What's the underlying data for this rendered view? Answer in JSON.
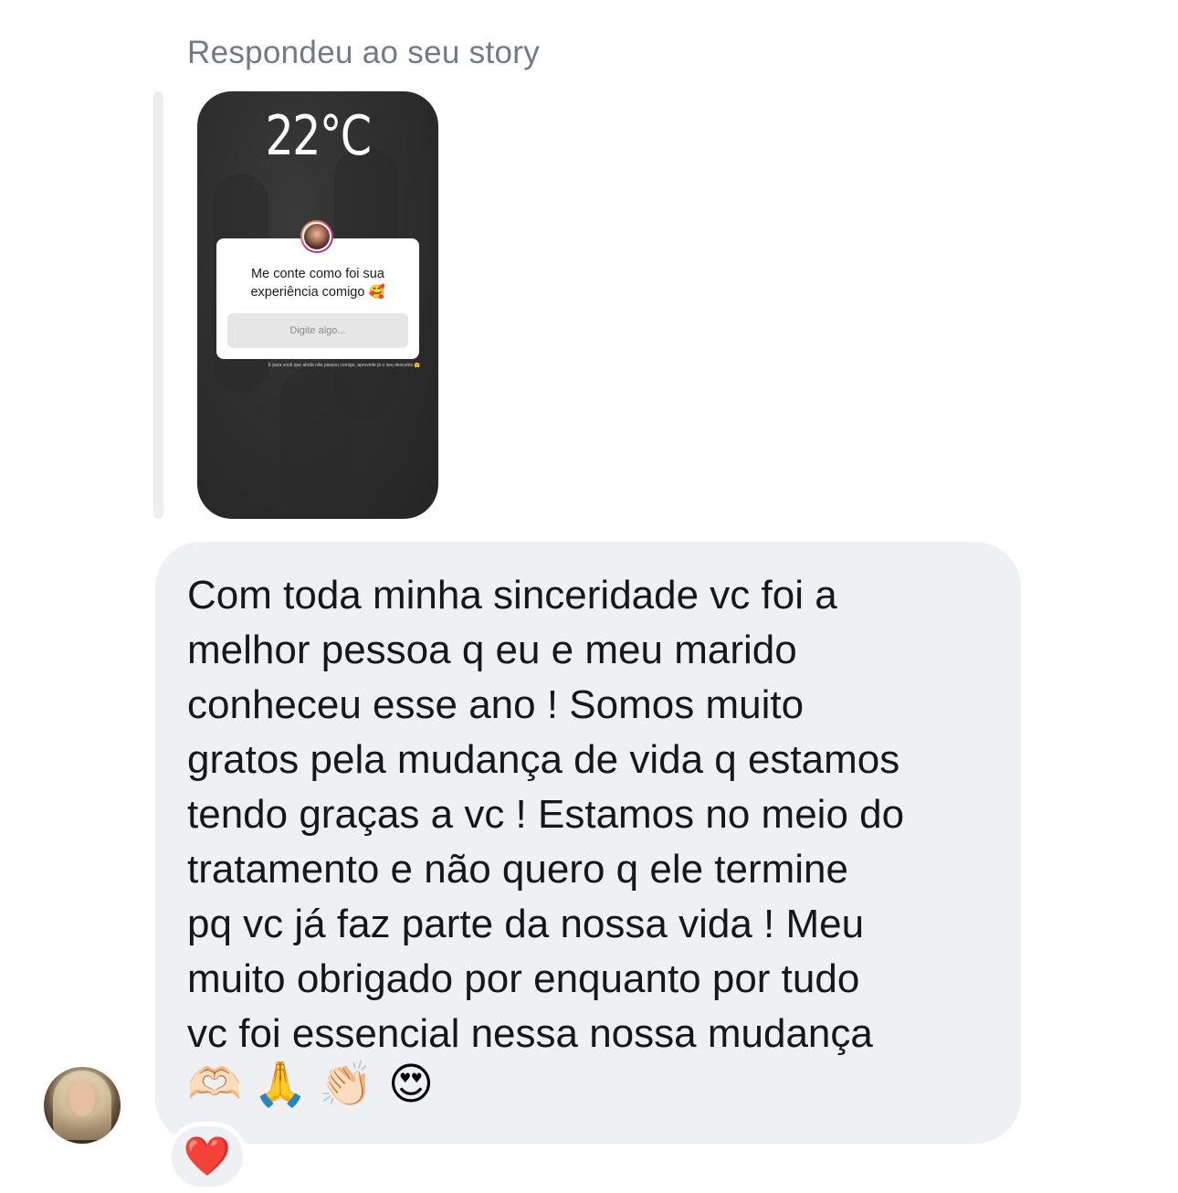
{
  "reply_header": "Respondeu ao seu story",
  "story": {
    "temperature": "22°C",
    "question": "Me conte como foi sua experiência comigo 🥰",
    "input_placeholder": "Digite algo...",
    "footnote": "E para você que ainda não passou comigo, aproveite já o seu desconto 🤗"
  },
  "message": {
    "text": "Com toda minha sinceridade vc foi a\nmelhor pessoa q eu e meu marido\nconheceu esse ano ! Somos muito\ngratos pela mudança de vida q estamos\ntendo graças a vc ! Estamos no meio do\ntratamento e não quero q ele termine\npq vc já faz parte da nossa vida ! Meu\nmuito obrigado por enquanto por tudo\nvc foi essencial nessa nossa mudança",
    "emojis": [
      "🫶🏻",
      "🙏",
      "👏🏻",
      "😍"
    ]
  },
  "reaction": "❤️",
  "colors": {
    "bubble": "#eff0f4",
    "header_text": "#737a84",
    "message_text": "#15171b",
    "reaction_heart": "#e3102a"
  }
}
